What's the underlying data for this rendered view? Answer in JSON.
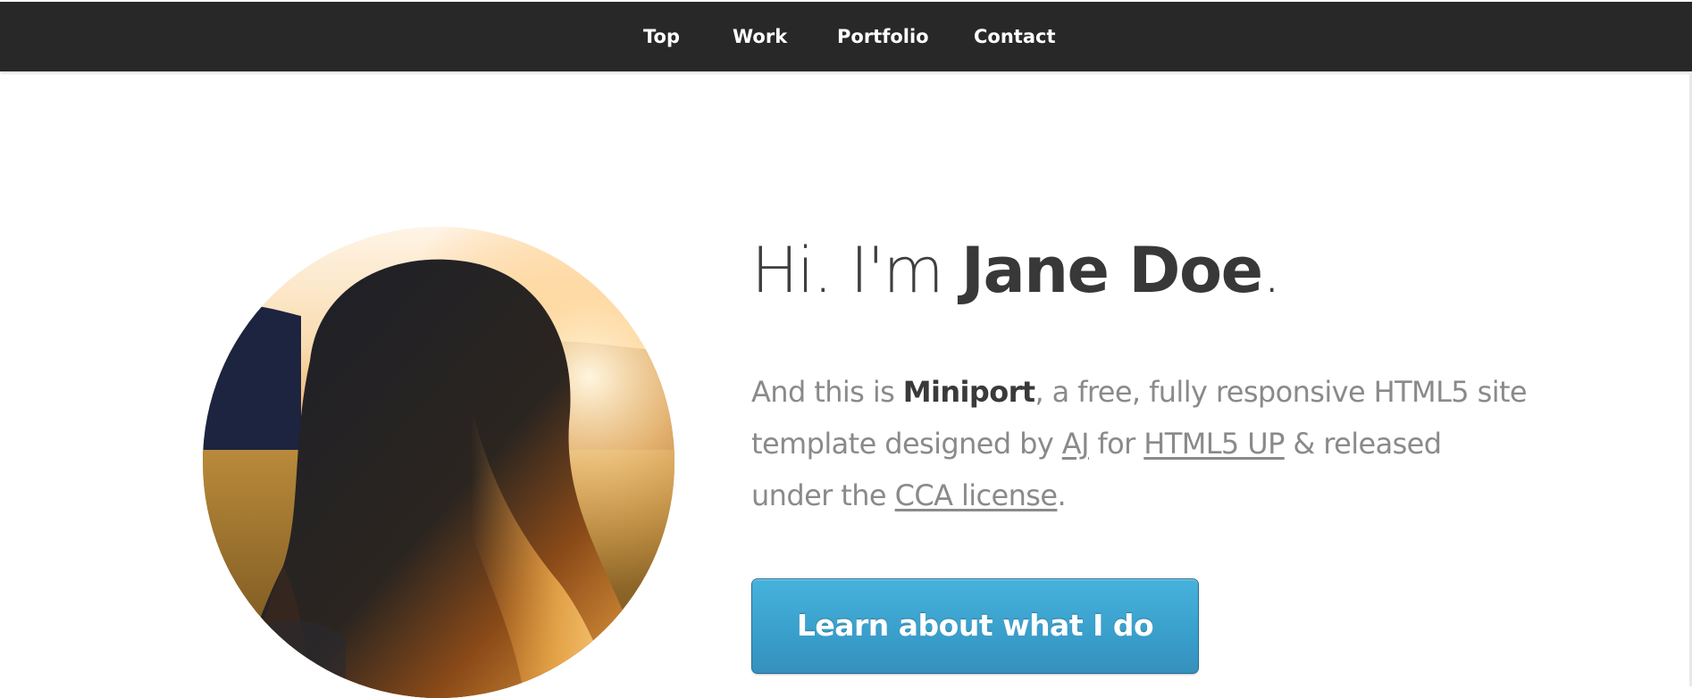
{
  "nav": {
    "items": [
      {
        "label": "Top"
      },
      {
        "label": "Work"
      },
      {
        "label": "Portfolio"
      },
      {
        "label": "Contact"
      }
    ]
  },
  "hero": {
    "greeting": "Hi. I'm ",
    "name": "Jane Doe",
    "greeting_end": ".",
    "intro": {
      "line1_pre": "And this is ",
      "brand": "Miniport",
      "line1_post": ", a free, fully responsive HTML5 site",
      "line2_pre": "template designed by ",
      "designer_link": "AJ",
      "line2_mid": " for ",
      "publisher_link": "HTML5 UP",
      "line2_post": " & released",
      "line3_pre": "under the ",
      "license_link": "CCA license",
      "line3_post": "."
    },
    "cta_label": "Learn about what I do",
    "photo_alt": "portrait-photo"
  },
  "colors": {
    "nav_bg": "#282828",
    "cta_blue": "#3fa9d6",
    "text_dark": "#3a3a3a",
    "text_muted": "#8a8a8a"
  }
}
